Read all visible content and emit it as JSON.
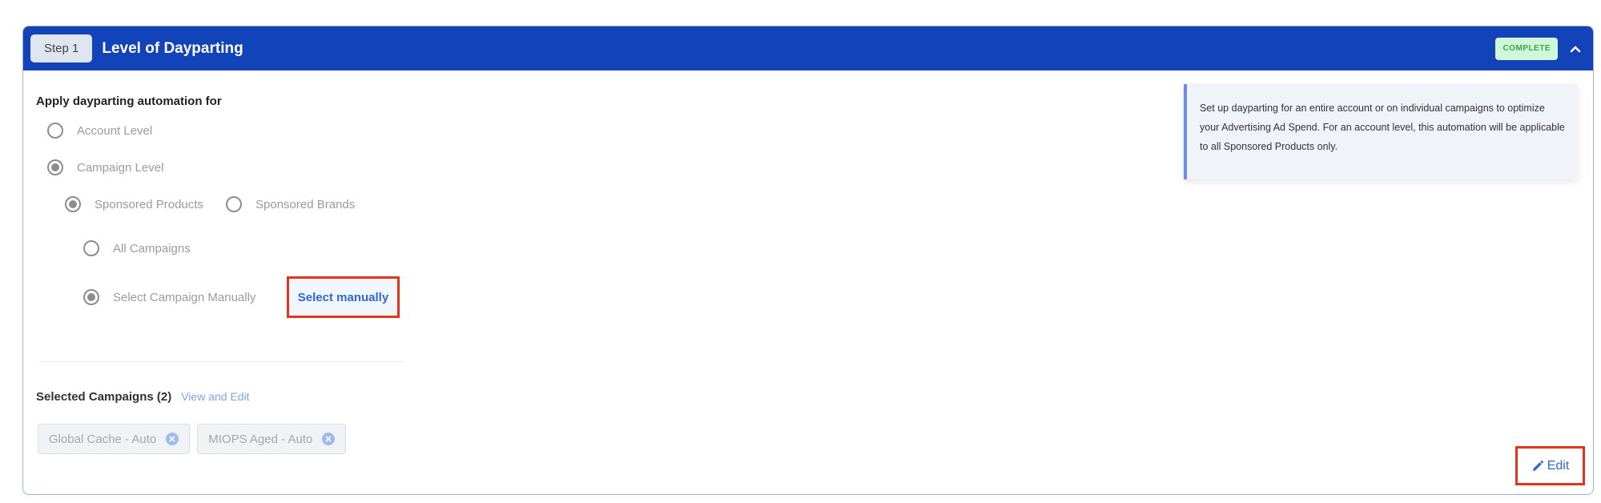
{
  "header": {
    "step_label": "Step 1",
    "title": "Level of Dayparting",
    "status_badge": "COMPLETE",
    "collapse_icon": "chevron-up-icon"
  },
  "form": {
    "section_title": "Apply dayparting automation for",
    "level_options": [
      {
        "label": "Account Level",
        "checked": false
      },
      {
        "label": "Campaign Level",
        "checked": true
      }
    ],
    "ad_type_options": [
      {
        "label": "Sponsored Products",
        "checked": true
      },
      {
        "label": "Sponsored Brands",
        "checked": false
      }
    ],
    "campaign_scope_options": [
      {
        "label": "All Campaigns",
        "checked": false
      },
      {
        "label": "Select Campaign Manually",
        "checked": true
      }
    ],
    "select_manually_button": "Select manually"
  },
  "selected_campaigns": {
    "label": "Selected Campaigns (2)",
    "view_edit_link": "View and Edit",
    "chips": [
      {
        "label": "Global Cache - Auto",
        "remove_icon": "remove-circle-icon"
      },
      {
        "label": "MIOPS Aged - Auto",
        "remove_icon": "remove-circle-icon"
      }
    ]
  },
  "info": {
    "text": "Set up dayparting for an entire account or on individual campaigns to optimize your Advertising Ad Spend. For an account level, this automation will be applicable to all Sponsored Products only."
  },
  "footer": {
    "edit_button": "Edit",
    "edit_icon": "pencil-icon"
  },
  "colors": {
    "header_bg": "#1343b8",
    "complete_bg": "#cff7d8",
    "complete_text": "#38a556",
    "link": "#2f67d8",
    "highlight_border": "#e5341b",
    "info_accent": "#6d8ee0"
  }
}
